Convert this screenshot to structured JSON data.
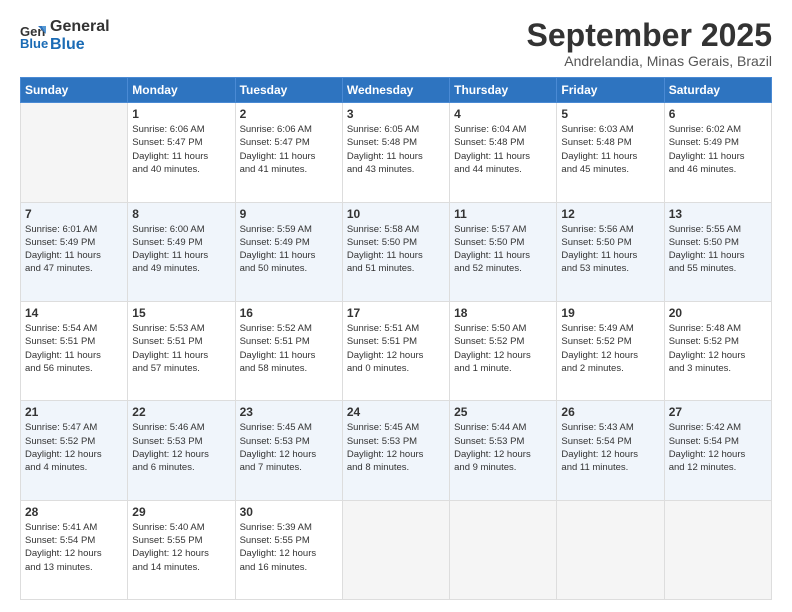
{
  "header": {
    "logo_line1": "General",
    "logo_line2": "Blue",
    "month": "September 2025",
    "location": "Andrelandia, Minas Gerais, Brazil"
  },
  "days_of_week": [
    "Sunday",
    "Monday",
    "Tuesday",
    "Wednesday",
    "Thursday",
    "Friday",
    "Saturday"
  ],
  "weeks": [
    [
      {
        "day": "",
        "info": ""
      },
      {
        "day": "1",
        "info": "Sunrise: 6:06 AM\nSunset: 5:47 PM\nDaylight: 11 hours\nand 40 minutes."
      },
      {
        "day": "2",
        "info": "Sunrise: 6:06 AM\nSunset: 5:47 PM\nDaylight: 11 hours\nand 41 minutes."
      },
      {
        "day": "3",
        "info": "Sunrise: 6:05 AM\nSunset: 5:48 PM\nDaylight: 11 hours\nand 43 minutes."
      },
      {
        "day": "4",
        "info": "Sunrise: 6:04 AM\nSunset: 5:48 PM\nDaylight: 11 hours\nand 44 minutes."
      },
      {
        "day": "5",
        "info": "Sunrise: 6:03 AM\nSunset: 5:48 PM\nDaylight: 11 hours\nand 45 minutes."
      },
      {
        "day": "6",
        "info": "Sunrise: 6:02 AM\nSunset: 5:49 PM\nDaylight: 11 hours\nand 46 minutes."
      }
    ],
    [
      {
        "day": "7",
        "info": "Sunrise: 6:01 AM\nSunset: 5:49 PM\nDaylight: 11 hours\nand 47 minutes."
      },
      {
        "day": "8",
        "info": "Sunrise: 6:00 AM\nSunset: 5:49 PM\nDaylight: 11 hours\nand 49 minutes."
      },
      {
        "day": "9",
        "info": "Sunrise: 5:59 AM\nSunset: 5:49 PM\nDaylight: 11 hours\nand 50 minutes."
      },
      {
        "day": "10",
        "info": "Sunrise: 5:58 AM\nSunset: 5:50 PM\nDaylight: 11 hours\nand 51 minutes."
      },
      {
        "day": "11",
        "info": "Sunrise: 5:57 AM\nSunset: 5:50 PM\nDaylight: 11 hours\nand 52 minutes."
      },
      {
        "day": "12",
        "info": "Sunrise: 5:56 AM\nSunset: 5:50 PM\nDaylight: 11 hours\nand 53 minutes."
      },
      {
        "day": "13",
        "info": "Sunrise: 5:55 AM\nSunset: 5:50 PM\nDaylight: 11 hours\nand 55 minutes."
      }
    ],
    [
      {
        "day": "14",
        "info": "Sunrise: 5:54 AM\nSunset: 5:51 PM\nDaylight: 11 hours\nand 56 minutes."
      },
      {
        "day": "15",
        "info": "Sunrise: 5:53 AM\nSunset: 5:51 PM\nDaylight: 11 hours\nand 57 minutes."
      },
      {
        "day": "16",
        "info": "Sunrise: 5:52 AM\nSunset: 5:51 PM\nDaylight: 11 hours\nand 58 minutes."
      },
      {
        "day": "17",
        "info": "Sunrise: 5:51 AM\nSunset: 5:51 PM\nDaylight: 12 hours\nand 0 minutes."
      },
      {
        "day": "18",
        "info": "Sunrise: 5:50 AM\nSunset: 5:52 PM\nDaylight: 12 hours\nand 1 minute."
      },
      {
        "day": "19",
        "info": "Sunrise: 5:49 AM\nSunset: 5:52 PM\nDaylight: 12 hours\nand 2 minutes."
      },
      {
        "day": "20",
        "info": "Sunrise: 5:48 AM\nSunset: 5:52 PM\nDaylight: 12 hours\nand 3 minutes."
      }
    ],
    [
      {
        "day": "21",
        "info": "Sunrise: 5:47 AM\nSunset: 5:52 PM\nDaylight: 12 hours\nand 4 minutes."
      },
      {
        "day": "22",
        "info": "Sunrise: 5:46 AM\nSunset: 5:53 PM\nDaylight: 12 hours\nand 6 minutes."
      },
      {
        "day": "23",
        "info": "Sunrise: 5:45 AM\nSunset: 5:53 PM\nDaylight: 12 hours\nand 7 minutes."
      },
      {
        "day": "24",
        "info": "Sunrise: 5:45 AM\nSunset: 5:53 PM\nDaylight: 12 hours\nand 8 minutes."
      },
      {
        "day": "25",
        "info": "Sunrise: 5:44 AM\nSunset: 5:53 PM\nDaylight: 12 hours\nand 9 minutes."
      },
      {
        "day": "26",
        "info": "Sunrise: 5:43 AM\nSunset: 5:54 PM\nDaylight: 12 hours\nand 11 minutes."
      },
      {
        "day": "27",
        "info": "Sunrise: 5:42 AM\nSunset: 5:54 PM\nDaylight: 12 hours\nand 12 minutes."
      }
    ],
    [
      {
        "day": "28",
        "info": "Sunrise: 5:41 AM\nSunset: 5:54 PM\nDaylight: 12 hours\nand 13 minutes."
      },
      {
        "day": "29",
        "info": "Sunrise: 5:40 AM\nSunset: 5:55 PM\nDaylight: 12 hours\nand 14 minutes."
      },
      {
        "day": "30",
        "info": "Sunrise: 5:39 AM\nSunset: 5:55 PM\nDaylight: 12 hours\nand 16 minutes."
      },
      {
        "day": "",
        "info": ""
      },
      {
        "day": "",
        "info": ""
      },
      {
        "day": "",
        "info": ""
      },
      {
        "day": "",
        "info": ""
      }
    ]
  ]
}
